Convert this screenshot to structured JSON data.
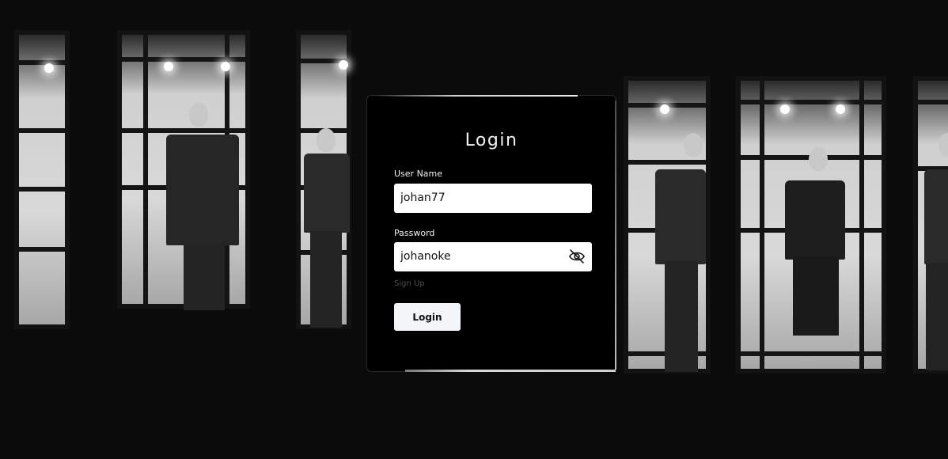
{
  "login_card": {
    "title": "Login",
    "username": {
      "label": "User Name",
      "value": "johan77"
    },
    "password": {
      "label": "Password",
      "value": "johanoke",
      "toggle_icon": "eye-slash-icon"
    },
    "signup_link": "Sign Up",
    "submit_label": "Login"
  },
  "colors": {
    "card_background": "#000000",
    "field_background": "#ffffff",
    "button_background": "#f3f6f8",
    "signup_text": "#4d4d4d"
  }
}
